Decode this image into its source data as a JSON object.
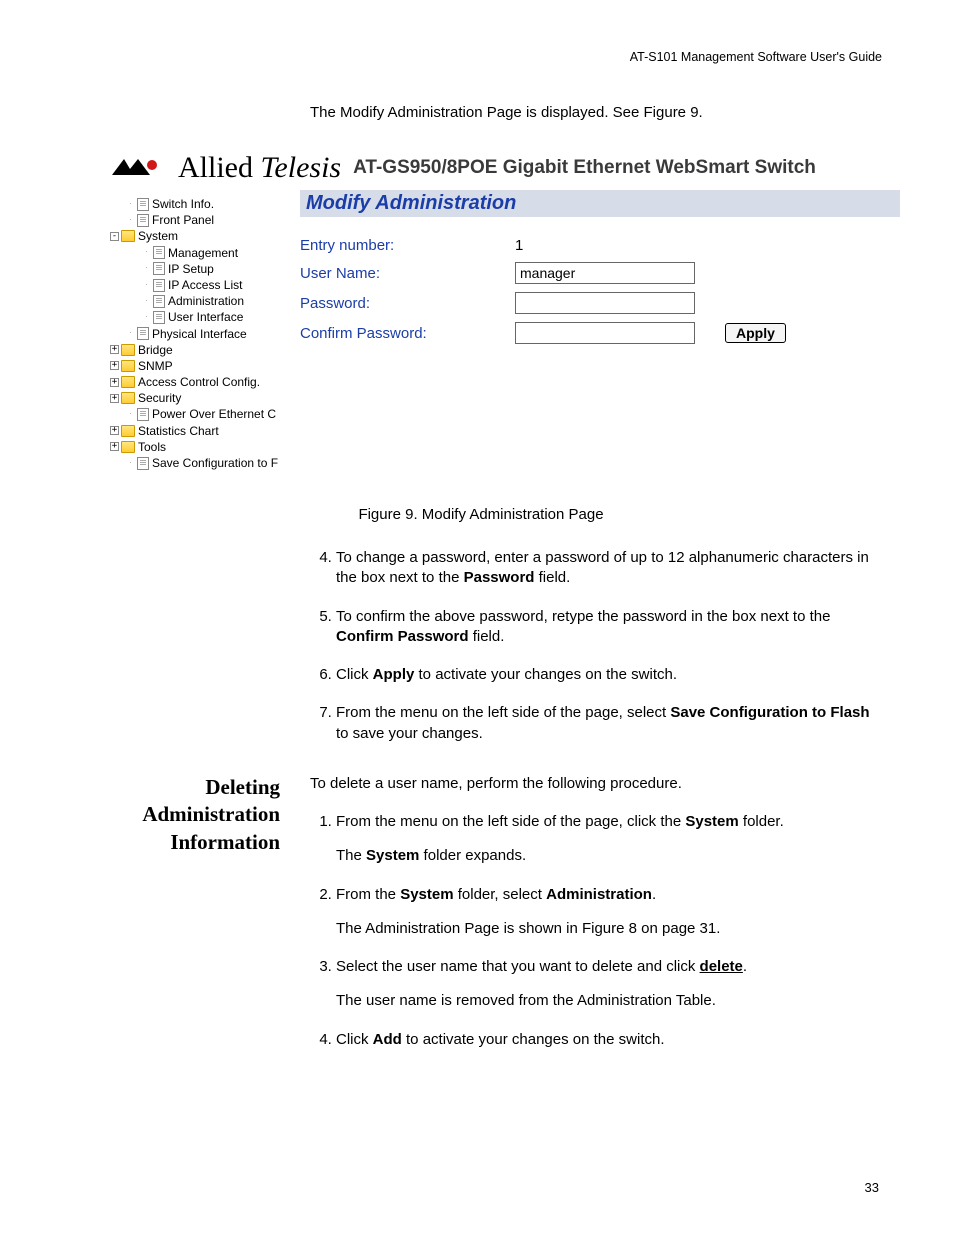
{
  "header": {
    "guide": "AT-S101 Management Software User's Guide"
  },
  "intro": "The Modify Administration Page is displayed. See Figure 9.",
  "figure": {
    "brand": "Allied Telesis",
    "product": "AT-GS950/8POE Gigabit Ethernet WebSmart Switch",
    "panel_title": "Modify Administration",
    "tree": {
      "switch_info": "Switch Info.",
      "front_panel": "Front Panel",
      "system": "System",
      "management": "Management",
      "ip_setup": "IP Setup",
      "ip_access": "IP Access List",
      "administration": "Administration",
      "user_interface": "User Interface",
      "physical": "Physical Interface",
      "bridge": "Bridge",
      "snmp": "SNMP",
      "acl": "Access Control Config.",
      "security": "Security",
      "poe": "Power Over Ethernet C",
      "stats": "Statistics Chart",
      "tools": "Tools",
      "save": "Save Configuration to F"
    },
    "form": {
      "entry_label": "Entry number:",
      "entry_value": "1",
      "user_label": "User Name:",
      "user_value": "manager",
      "password_label": "Password:",
      "confirm_label": "Confirm Password:",
      "apply": "Apply"
    },
    "caption": "Figure 9. Modify Administration Page"
  },
  "steps_a": {
    "s4_a": "To change a password, enter a password of up to 12 alphanumeric characters in the box next to the ",
    "s4_b": "Password",
    "s4_c": " field.",
    "s5_a": "To confirm the above password, retype the password in the box next to the ",
    "s5_b": "Confirm Password",
    "s5_c": " field.",
    "s6_a": "Click ",
    "s6_b": "Apply",
    "s6_c": " to activate your changes on the switch.",
    "s7_a": "From the menu on the left side of the page, select ",
    "s7_b": "Save Configuration to Flash",
    "s7_c": " to save your changes."
  },
  "section2": {
    "heading": "Deleting Administration Information",
    "intro": "To delete a user name, perform the following procedure.",
    "s1_a": "From the menu on the left side of the page, click the ",
    "s1_b": "System",
    "s1_c": " folder.",
    "s1_sub_a": "The ",
    "s1_sub_b": "System",
    "s1_sub_c": " folder expands.",
    "s2_a": "From the ",
    "s2_b": "System",
    "s2_c": " folder, select ",
    "s2_d": "Administration",
    "s2_e": ".",
    "s2_sub": "The Administration Page is shown in Figure 8 on page 31.",
    "s3_a": "Select the user name that you want to delete and click ",
    "s3_b": "delete",
    "s3_c": ".",
    "s3_sub": "The user name is removed from the Administration Table.",
    "s4_a": "Click ",
    "s4_b": "Add",
    "s4_c": " to activate your changes on the switch."
  },
  "page_number": "33"
}
